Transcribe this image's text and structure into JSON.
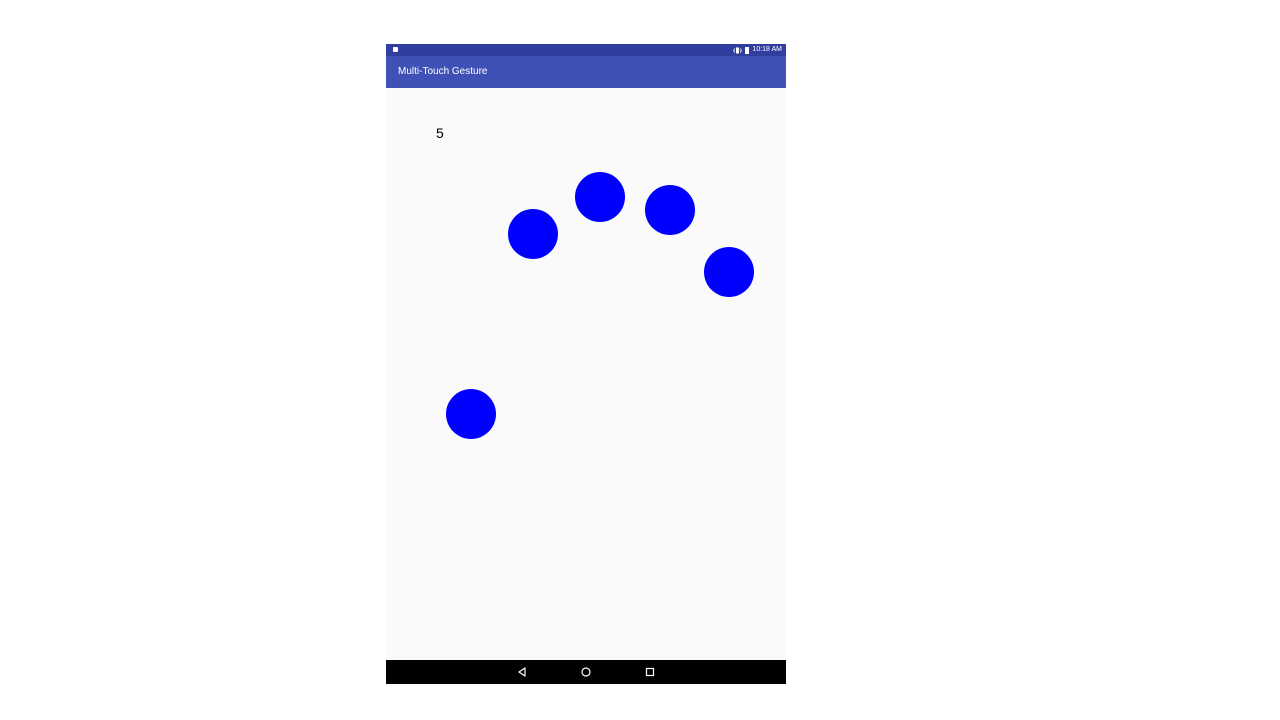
{
  "status_bar": {
    "time": "10:18 AM",
    "icons": [
      "notification-dot-icon",
      "vibrate-icon",
      "battery-icon"
    ]
  },
  "app_bar": {
    "title": "Multi-Touch Gesture",
    "color": "#3f51b5",
    "status_color": "#303f9f"
  },
  "content": {
    "pointer_count": "5",
    "touch_point_color": "#0000ff",
    "touch_points_count": 5
  },
  "nav_bar": {
    "buttons": [
      "back-icon",
      "home-icon",
      "recents-icon"
    ]
  }
}
